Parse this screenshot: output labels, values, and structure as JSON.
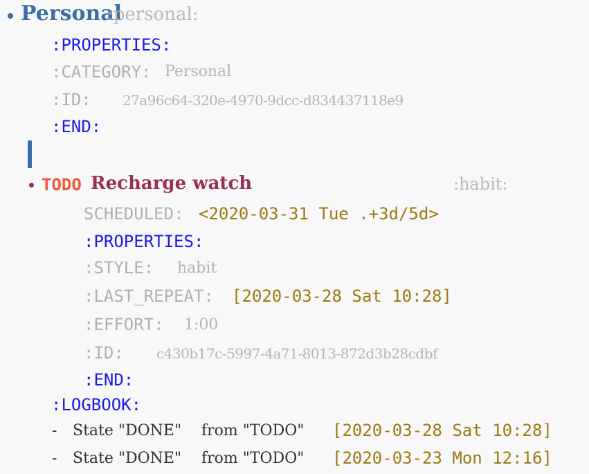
{
  "heading1": {
    "title": "Personal",
    "tag": ":personal:",
    "bullet_color": "#3a6ea5"
  },
  "drawer1": {
    "open": ":PROPERTIES:",
    "category_key": ":CATEGORY:",
    "category_value": "Personal",
    "id_key": ":ID:",
    "id_value": "27a96c64-320e-4970-9dcc-d834437118e9",
    "end": ":END:"
  },
  "heading2": {
    "keyword": "TODO",
    "title": "Recharge watch",
    "tag": ":habit:",
    "bullet_color": "#9a3050"
  },
  "scheduled": {
    "key": "SCHEDULED:",
    "value": "<2020-03-31 Tue .+3d/5d>"
  },
  "drawer2": {
    "open": ":PROPERTIES:",
    "style_key": ":STYLE:",
    "style_value": "habit",
    "last_repeat_key": ":LAST_REPEAT:",
    "last_repeat_value": "[2020-03-28 Sat 10:28]",
    "effort_key": ":EFFORT:",
    "effort_value": "1:00",
    "id_key": ":ID:",
    "id_value": "c430b17c-5997-4a71-8013-872d3b28cdbf",
    "end": ":END:"
  },
  "logbook": {
    "label": ":LOGBOOK:",
    "entries": [
      {
        "dash": "-",
        "state": "State \"DONE\"",
        "from": "from \"TODO\"",
        "timestamp": "[2020-03-28 Sat 10:28]"
      },
      {
        "dash": "-",
        "state": "State \"DONE\"",
        "from": "from \"TODO\"",
        "timestamp": "[2020-03-23 Mon 12:16]"
      }
    ]
  },
  "colors": {
    "background": "#f8f8f8",
    "heading1": "#3a6ea5",
    "heading2": "#9a3050",
    "todo": "#f05a3c",
    "drawer": "#1a1ae6",
    "muted": "#b0b0b0",
    "date": "#9a7a10",
    "text": "#303030"
  }
}
